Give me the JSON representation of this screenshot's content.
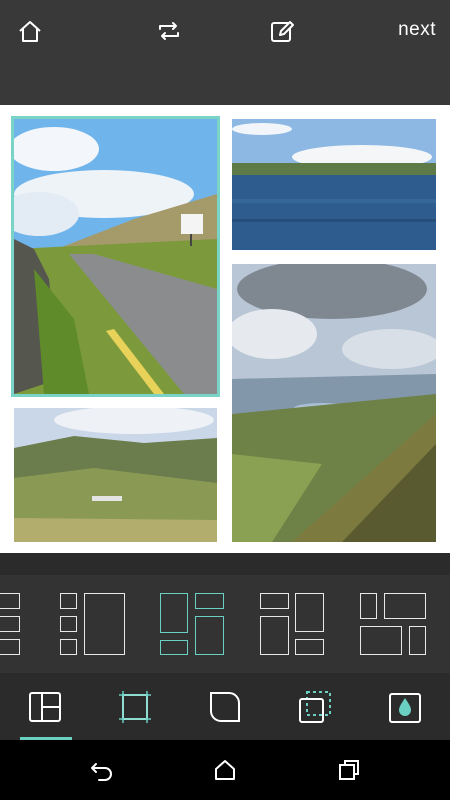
{
  "header": {
    "home_icon": "home-icon",
    "swap_icon": "swap-icon",
    "edit_icon": "edit-icon",
    "next_label": "next"
  },
  "collage": {
    "photos": [
      {
        "name": "road-photo",
        "selected": true
      },
      {
        "name": "lake-photo",
        "selected": false
      },
      {
        "name": "valley-photo",
        "selected": false
      },
      {
        "name": "mountain-valley-photo",
        "selected": false
      }
    ],
    "selection_color": "#79d3c7"
  },
  "layouts": {
    "selected_index": 2,
    "accent": "#6ad0c2"
  },
  "toolbar": {
    "tools": [
      "layout-tool-icon",
      "border-tool-icon",
      "corner-tool-icon",
      "crop-tool-icon",
      "color-tool-icon"
    ],
    "selected_tool": "layout-tool-icon"
  },
  "navigation": {
    "back_icon": "back-icon",
    "home_icon": "home-icon",
    "recents_icon": "recents-icon"
  }
}
